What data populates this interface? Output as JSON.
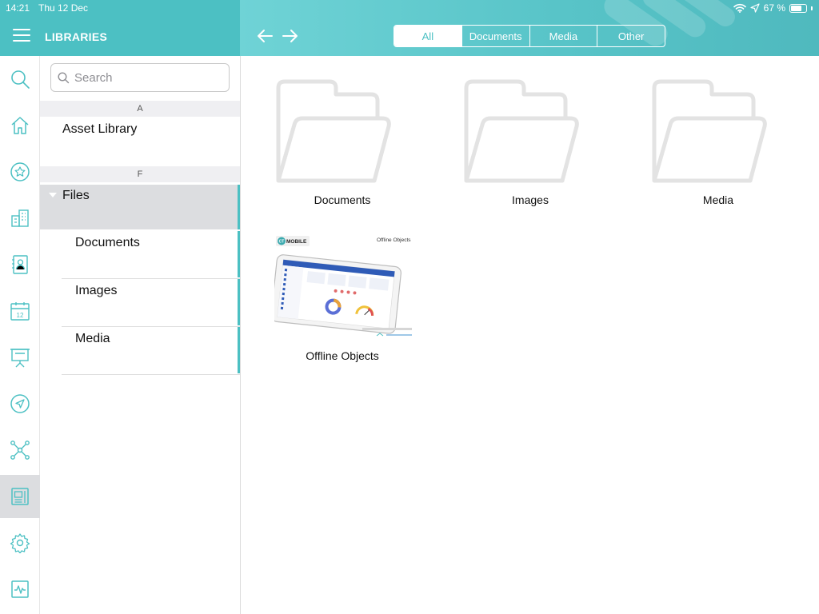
{
  "status_bar": {
    "time": "14:21",
    "date": "Thu 12 Dec",
    "battery": "67 %"
  },
  "header": {
    "title": "LIBRARIES"
  },
  "filter_tabs": [
    {
      "label": "All",
      "active": true
    },
    {
      "label": "Documents",
      "active": false
    },
    {
      "label": "Media",
      "active": false
    },
    {
      "label": "Other",
      "active": false
    }
  ],
  "rail": {
    "items": [
      "search-icon",
      "home-icon",
      "star-icon",
      "buildings-icon",
      "contact-book-icon",
      "calendar-icon",
      "presentation-icon",
      "navigation-icon",
      "network-icon",
      "library-icon",
      "gear-icon",
      "activity-icon"
    ],
    "calendar_day": "12",
    "active": "library-icon"
  },
  "library_pane": {
    "search_placeholder": "Search",
    "sections": [
      {
        "letter": "A",
        "items": [
          "Asset Library"
        ]
      },
      {
        "letter": "F",
        "items": [
          "Files"
        ]
      }
    ],
    "files_children": [
      "Documents",
      "Images",
      "Media"
    ]
  },
  "content": {
    "folders": [
      "Documents",
      "Images",
      "Media"
    ],
    "objects": [
      {
        "title": "Offline Objects",
        "thumb_brand": "MOBILE",
        "thumb_brand_badge": "CT",
        "thumb_title": "Offline Objects"
      }
    ]
  },
  "colors": {
    "accent": "#4cc0c3",
    "selected_row": "#dcdde0",
    "folder_stroke": "#e3e3e3"
  }
}
